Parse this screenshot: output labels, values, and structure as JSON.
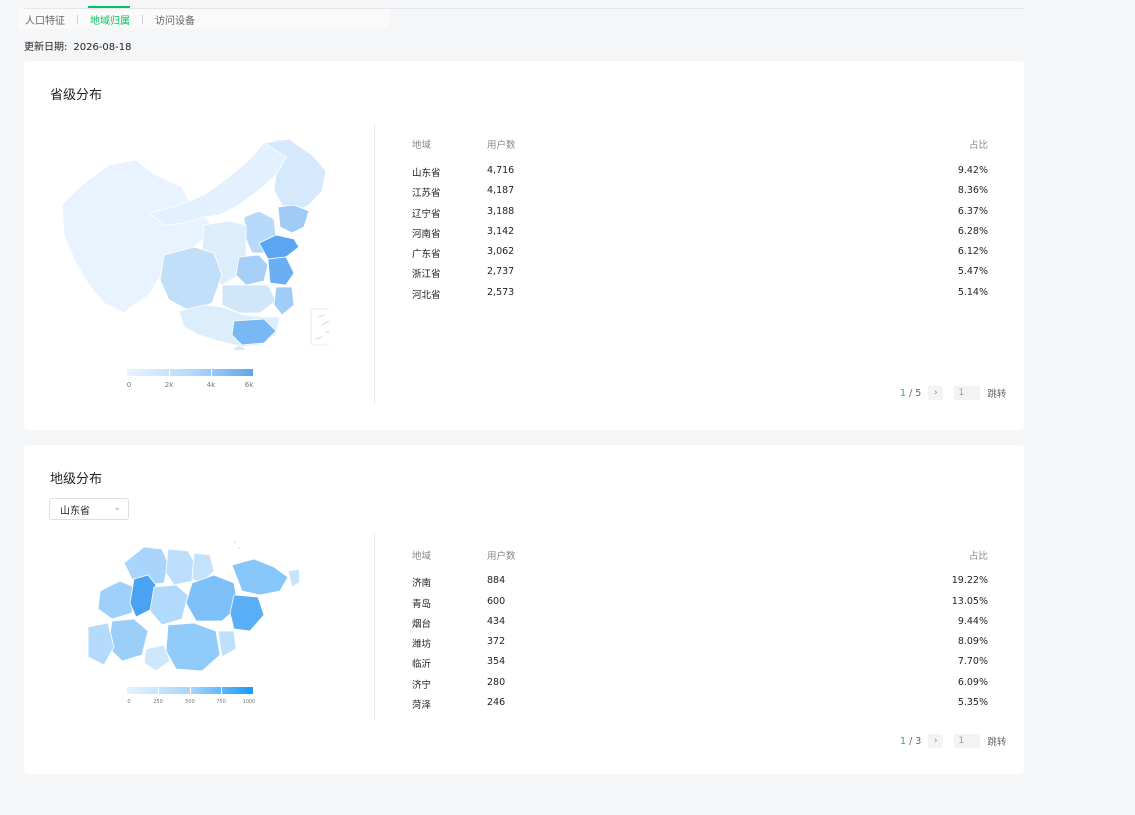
{
  "subnav": {
    "items": [
      {
        "label": "人口特征",
        "active": false
      },
      {
        "label": "地域归属",
        "active": true
      },
      {
        "label": "访问设备",
        "active": false
      }
    ]
  },
  "update": {
    "label": "更新日期:",
    "value": "2026-08-18"
  },
  "province_card": {
    "title": "省级分布",
    "legend": [
      "0",
      "2k",
      "4k",
      "6k"
    ],
    "table": {
      "headers": [
        "地域",
        "用户数",
        "占比"
      ],
      "rows": [
        [
          "山东省",
          "4,716",
          "9.42%"
        ],
        [
          "江苏省",
          "4,187",
          "8.36%"
        ],
        [
          "辽宁省",
          "3,188",
          "6.37%"
        ],
        [
          "河南省",
          "3,142",
          "6.28%"
        ],
        [
          "广东省",
          "3,062",
          "6.12%"
        ],
        [
          "浙江省",
          "2,737",
          "5.47%"
        ],
        [
          "河北省",
          "2,573",
          "5.14%"
        ]
      ]
    },
    "pager": {
      "current": "1",
      "total": "/ 5",
      "input": "1",
      "jump": "跳转"
    }
  },
  "city_card": {
    "title": "地级分布",
    "select_value": "山东省",
    "legend": [
      "0",
      "250",
      "500",
      "750",
      "1000"
    ],
    "table": {
      "headers": [
        "地域",
        "用户数",
        "占比"
      ],
      "rows": [
        [
          "济南",
          "884",
          "19.22%"
        ],
        [
          "青岛",
          "600",
          "13.05%"
        ],
        [
          "烟台",
          "434",
          "9.44%"
        ],
        [
          "潍坊",
          "372",
          "8.09%"
        ],
        [
          "临沂",
          "354",
          "7.70%"
        ],
        [
          "济宁",
          "280",
          "6.09%"
        ],
        [
          "菏泽",
          "246",
          "5.35%"
        ]
      ]
    },
    "pager": {
      "current": "1",
      "total": "/ 3",
      "input": "1",
      "jump": "跳转"
    }
  },
  "colors": {
    "accent": "#07c160",
    "map_low": "#e8f3ff",
    "map_high": "#5aa6f2"
  }
}
